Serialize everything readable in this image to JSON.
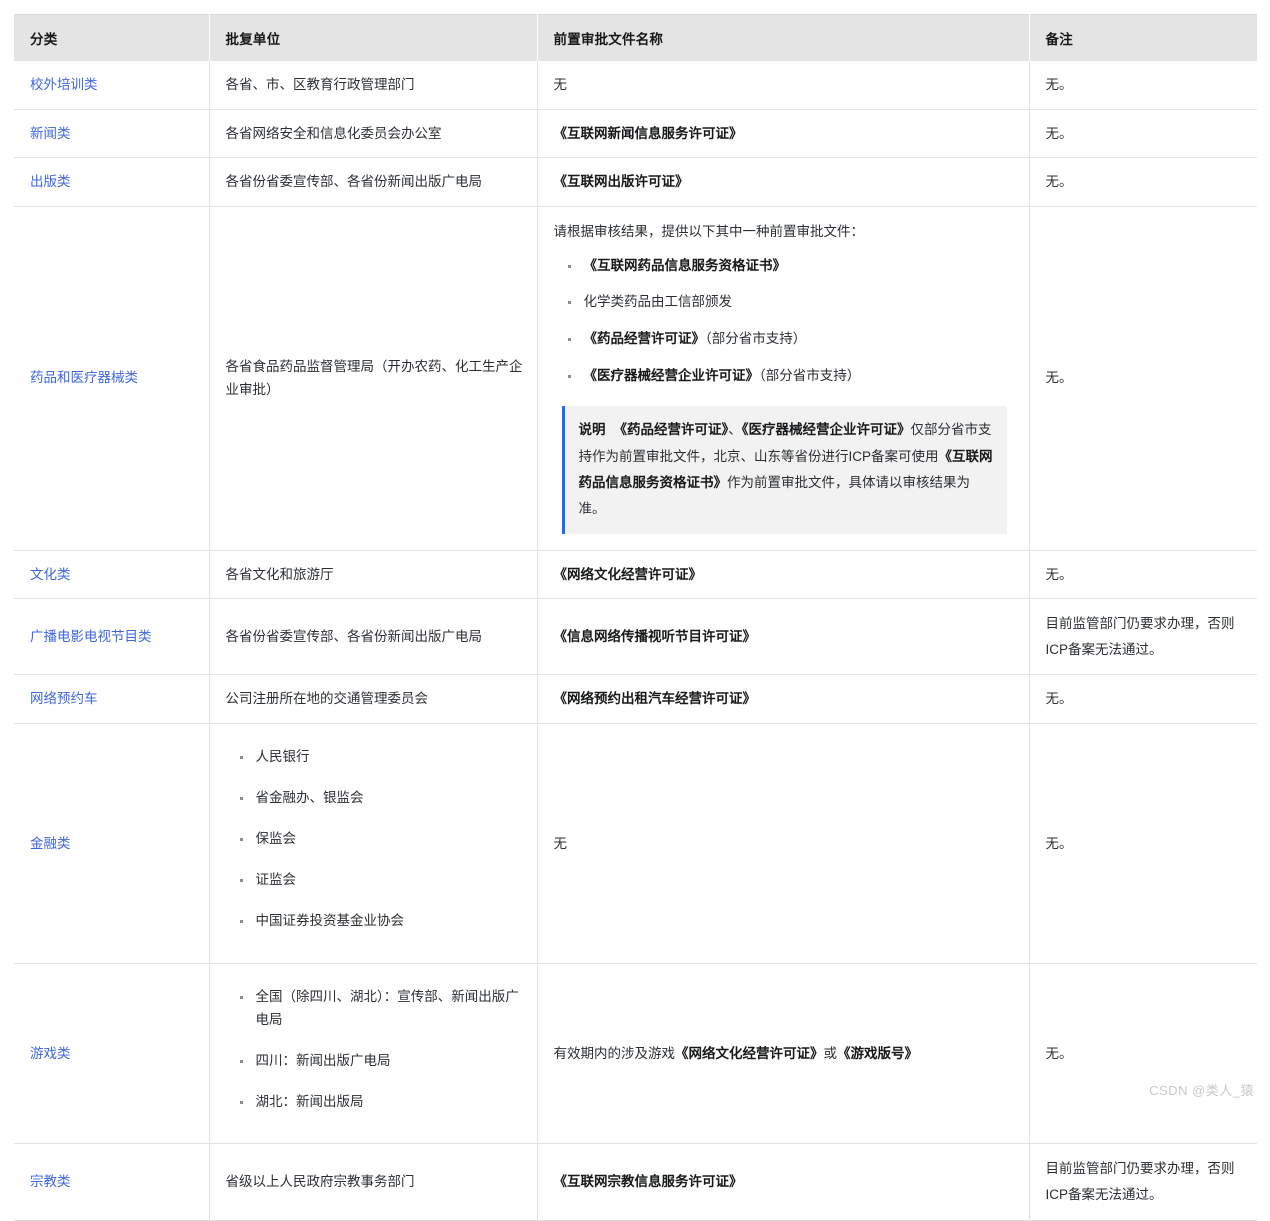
{
  "table": {
    "headers": [
      {
        "label": "分类"
      },
      {
        "label": "批复单位"
      },
      {
        "label": "前置审批文件名称"
      },
      {
        "label": "备注"
      }
    ],
    "rows": [
      {
        "category": "校外培训类",
        "authority": "各省、市、区教育行政管理部门",
        "document": "无",
        "remark": "无。"
      },
      {
        "category": "新闻类",
        "authority": "各省网络安全和信息化委员会办公室",
        "document": "《互联网新闻信息服务许可证》",
        "remark": "无。"
      },
      {
        "category": "出版类",
        "authority": "各省份省委宣传部、各省份新闻出版广电局",
        "document": "《互联网出版许可证》",
        "remark": "无。"
      },
      {
        "category": "药品和医疗器械类",
        "authority": "各省食品药品监督管理局（开办农药、化工生产企业审批）",
        "document_lead": "请根据审核结果，提供以下其中一种前置审批文件：",
        "document_items": [
          {
            "bold": "《互联网药品信息服务资格证书》",
            "tail": ""
          },
          {
            "bold": "",
            "tail": "化学类药品由工信部颁发"
          },
          {
            "bold": "《药品经营许可证》",
            "tail": "（部分省市支持）"
          },
          {
            "bold": "《医疗器械经营企业许可证》",
            "tail": "（部分省市支持）"
          }
        ],
        "note_label": "说明",
        "note_parts": [
          {
            "text": "《药品经营许可证》",
            "bold": true
          },
          {
            "text": "、",
            "bold": false
          },
          {
            "text": "《医疗器械经营企业许可证》",
            "bold": true
          },
          {
            "text": "仅部分省市支持作为前置审批文件，北京、山东等省份进行ICP备案可使用",
            "bold": false
          },
          {
            "text": "《互联网药品信息服务资格证书》",
            "bold": true
          },
          {
            "text": "作为前置审批文件，具体请以审核结果为准。",
            "bold": false
          }
        ],
        "remark": "无。"
      },
      {
        "category": "文化类",
        "authority": "各省文化和旅游厅",
        "document": "《网络文化经营许可证》",
        "remark": "无。"
      },
      {
        "category": "广播电影电视节目类",
        "authority": "各省份省委宣传部、各省份新闻出版广电局",
        "document": "《信息网络传播视听节目许可证》",
        "remark": "目前监管部门仍要求办理，否则ICP备案无法通过。"
      },
      {
        "category": "网络预约车",
        "authority": "公司注册所在地的交通管理委员会",
        "document": "《网络预约出租汽车经营许可证》",
        "remark": "无。"
      },
      {
        "category": "金融类",
        "authority_items": [
          "人民银行",
          "省金融办、银监会",
          "保监会",
          "证监会",
          "中国证券投资基金业协会"
        ],
        "document": "无",
        "remark": "无。"
      },
      {
        "category": "游戏类",
        "authority_items": [
          "全国（除四川、湖北）：宣传部、新闻出版广电局",
          "四川：新闻出版广电局",
          "湖北：新闻出版局"
        ],
        "document_parts": [
          {
            "text": "有效期内的涉及游戏",
            "bold": false
          },
          {
            "text": "《网络文化经营许可证》",
            "bold": true
          },
          {
            "text": "或",
            "bold": false
          },
          {
            "text": "《游戏版号》",
            "bold": true
          }
        ],
        "remark": "无。"
      },
      {
        "category": "宗教类",
        "authority": "省级以上人民政府宗教事务部门",
        "document": "《互联网宗教信息服务许可证》",
        "remark": "目前监管部门仍要求办理，否则ICP备案无法通过。"
      }
    ]
  },
  "watermark": "CSDN @类人_猿",
  "colors": {
    "link": "#3f66e0",
    "header_bg": "#e4e4e4",
    "note_border": "#1570ef",
    "note_bg": "#f2f2f2",
    "grid": "#e3e3e3"
  }
}
